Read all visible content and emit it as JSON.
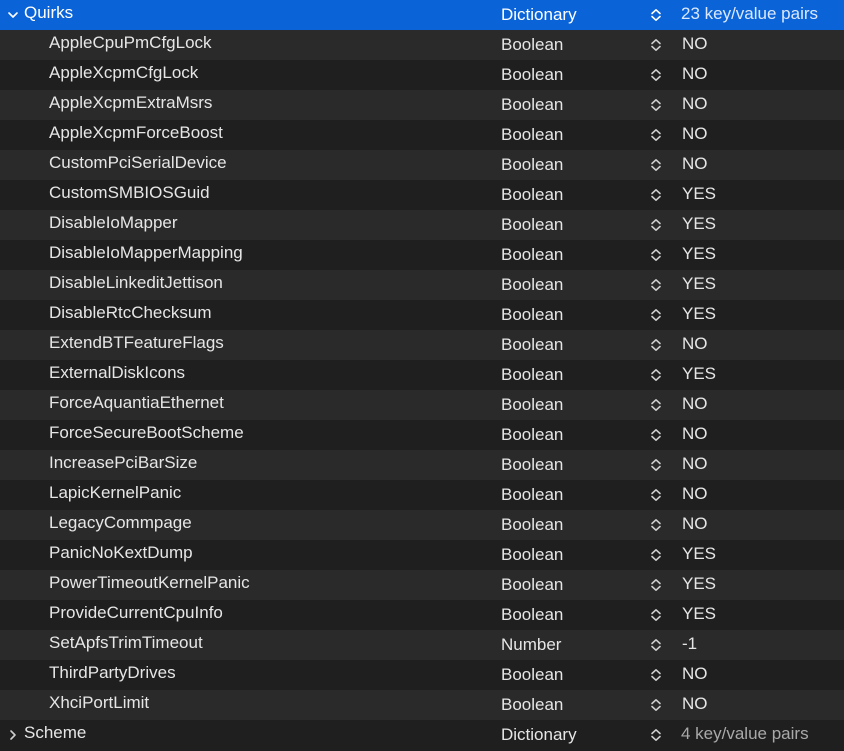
{
  "quirks": {
    "key": "Quirks",
    "type": "Dictionary",
    "value": "23 key/value pairs",
    "expanded": true,
    "disclosure_icon": "chevron-down-icon",
    "items": [
      {
        "key": "AppleCpuPmCfgLock",
        "type": "Boolean",
        "value": "NO"
      },
      {
        "key": "AppleXcpmCfgLock",
        "type": "Boolean",
        "value": "NO"
      },
      {
        "key": "AppleXcpmExtraMsrs",
        "type": "Boolean",
        "value": "NO"
      },
      {
        "key": "AppleXcpmForceBoost",
        "type": "Boolean",
        "value": "NO"
      },
      {
        "key": "CustomPciSerialDevice",
        "type": "Boolean",
        "value": "NO"
      },
      {
        "key": "CustomSMBIOSGuid",
        "type": "Boolean",
        "value": "YES"
      },
      {
        "key": "DisableIoMapper",
        "type": "Boolean",
        "value": "YES"
      },
      {
        "key": "DisableIoMapperMapping",
        "type": "Boolean",
        "value": "YES"
      },
      {
        "key": "DisableLinkeditJettison",
        "type": "Boolean",
        "value": "YES"
      },
      {
        "key": "DisableRtcChecksum",
        "type": "Boolean",
        "value": "YES"
      },
      {
        "key": "ExtendBTFeatureFlags",
        "type": "Boolean",
        "value": "NO"
      },
      {
        "key": "ExternalDiskIcons",
        "type": "Boolean",
        "value": "YES"
      },
      {
        "key": "ForceAquantiaEthernet",
        "type": "Boolean",
        "value": "NO"
      },
      {
        "key": "ForceSecureBootScheme",
        "type": "Boolean",
        "value": "NO"
      },
      {
        "key": "IncreasePciBarSize",
        "type": "Boolean",
        "value": "NO"
      },
      {
        "key": "LapicKernelPanic",
        "type": "Boolean",
        "value": "NO"
      },
      {
        "key": "LegacyCommpage",
        "type": "Boolean",
        "value": "NO"
      },
      {
        "key": "PanicNoKextDump",
        "type": "Boolean",
        "value": "YES"
      },
      {
        "key": "PowerTimeoutKernelPanic",
        "type": "Boolean",
        "value": "YES"
      },
      {
        "key": "ProvideCurrentCpuInfo",
        "type": "Boolean",
        "value": "YES"
      },
      {
        "key": "SetApfsTrimTimeout",
        "type": "Number",
        "value": "-1"
      },
      {
        "key": "ThirdPartyDrives",
        "type": "Boolean",
        "value": "NO"
      },
      {
        "key": "XhciPortLimit",
        "type": "Boolean",
        "value": "NO"
      }
    ]
  },
  "scheme": {
    "key": "Scheme",
    "type": "Dictionary",
    "value": "4 key/value pairs",
    "expanded": false,
    "disclosure_icon": "chevron-right-icon"
  },
  "colors": {
    "selection": "#0a64d8",
    "row_odd": "#2a2a2a",
    "row_even": "#1f1f1f",
    "text": "#e6e6e6"
  },
  "icons": {
    "stepper": "up-down-stepper-icon"
  }
}
